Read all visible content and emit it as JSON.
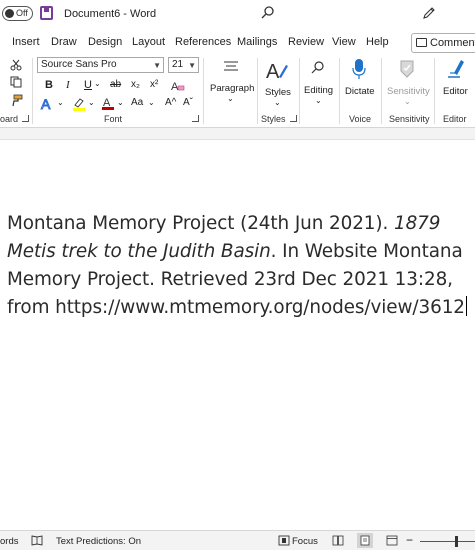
{
  "titlebar": {
    "autosave_label": "Off",
    "document_title": "Document6  -  Word"
  },
  "tabs": [
    "Insert",
    "Draw",
    "Design",
    "Layout",
    "References",
    "Mailings",
    "Review",
    "View",
    "Help"
  ],
  "comments_label": "Comments",
  "ribbon": {
    "font_name": "Source Sans Pro",
    "font_size": "21",
    "group_labels": {
      "clipboard": "oard",
      "font": "Font",
      "styles": "Styles",
      "voice": "Voice",
      "sensitivity": "Sensitivity",
      "editor": "Editor"
    },
    "buttons": {
      "paragraph": "Paragraph",
      "styles": "Styles",
      "editing": "Editing",
      "dictate": "Dictate",
      "sensitivity": "Sensitivity",
      "editor": "Editor"
    },
    "font_buttons": {
      "bold": "B",
      "italic": "I",
      "underline": "U",
      "strikethrough": "ab",
      "subscript": "x₂",
      "superscript": "x²",
      "change_case": "Aa",
      "grow": "A^",
      "shrink": "Aˇ"
    }
  },
  "document": {
    "text_before_italic": "Montana Memory Project (24th Jun 2021). ",
    "italic_text": "1879 Metis trek to the Judith Basin",
    "text_after_italic": ". In Website Montana Memory Project. Retrieved 23rd Dec 2021 13:28, from https://www.mtmemory.org/nodes/view/3612"
  },
  "statusbar": {
    "words": "ords",
    "text_predictions": "Text Predictions: On",
    "focus": "Focus"
  },
  "colors": {
    "accent_purple": "#7a3b98",
    "highlight_yellow": "#ffff00",
    "font_color_red": "#c00000",
    "text_effects_blue": "#2b6cd4",
    "dictate_blue": "#1e73c8"
  }
}
